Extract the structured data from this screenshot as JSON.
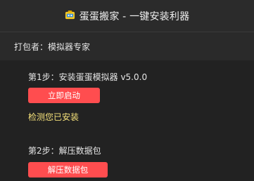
{
  "window": {
    "title": "蛋蛋搬家 - 一键安装利器",
    "icon": "app-logo-icon"
  },
  "packer": {
    "text": "打包者：模拟器专家"
  },
  "steps": [
    {
      "label": "第1步：安装蛋蛋模拟器 v5.0.0",
      "button_label": "立即启动",
      "status": "检测您已安装"
    },
    {
      "label": "第2步：解压数据包",
      "button_label": "解压数据包"
    }
  ],
  "colors": {
    "background": "#222222",
    "accent_button": "#ff4d4f",
    "status_text": "#f5e17a"
  }
}
